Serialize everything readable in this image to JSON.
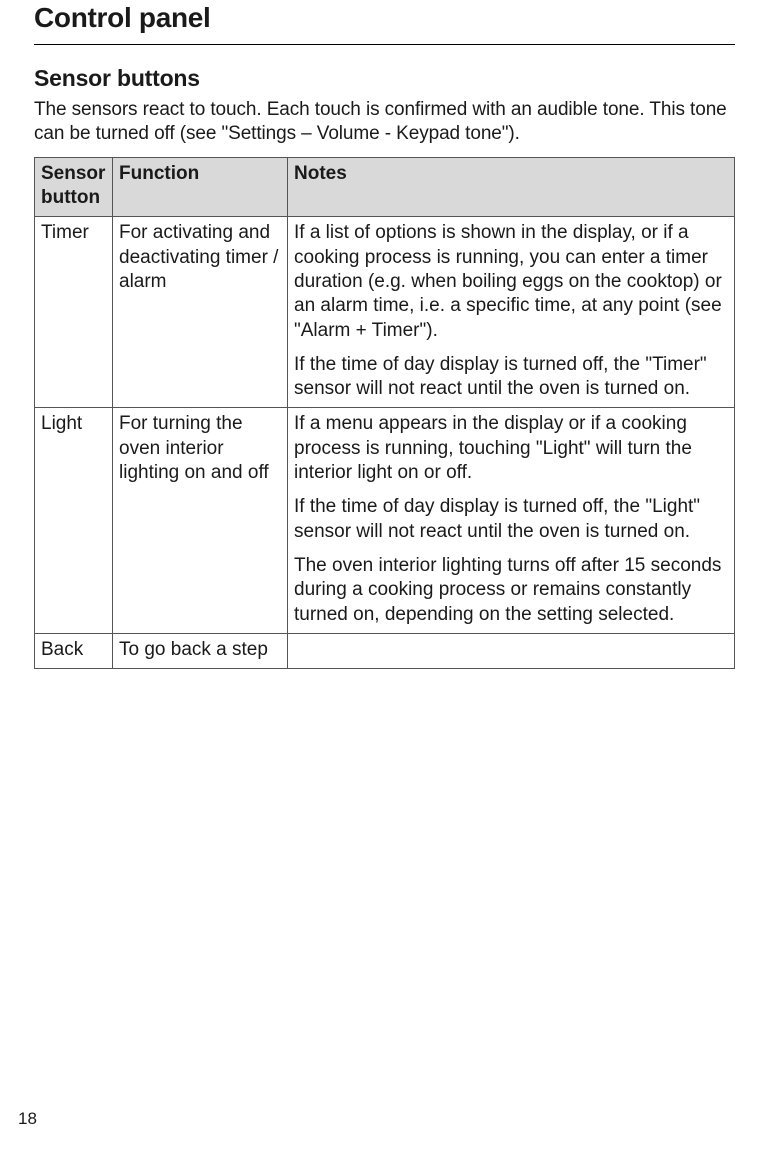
{
  "page_title": "Control panel",
  "section_title": "Sensor buttons",
  "intro_text": "The sensors react to touch. Each touch is confirmed with an audible tone. This tone can be turned off (see \"Settings – Volume - Keypad tone\").",
  "table": {
    "headers": {
      "col1": "Sensor button",
      "col2": "Function",
      "col3": "Notes"
    },
    "rows": [
      {
        "button": "Timer",
        "function": "For activating and deactivating timer / alarm",
        "notes": [
          "If a list of options is shown in the display, or if a cooking process is running, you can enter a timer duration (e.g. when boiling eggs on the cooktop) or an alarm time, i.e. a specific time, at any point (see \"Alarm + Timer\").",
          "If the time of day display is turned off, the \"Timer\" sensor will not react until the oven is turned on."
        ]
      },
      {
        "button": "Light",
        "function": "For turning the oven interior lighting on and off",
        "notes": [
          "If a menu appears in the display or if a cooking process is running, touching \"Light\" will turn the interior light on or off.",
          "If the time of day display is turned off, the \"Light\" sensor will not react until the oven is turned on.",
          "The oven interior lighting turns off after 15 seconds during a cooking process or remains constantly turned on, depending on the setting selected."
        ]
      },
      {
        "button": "Back",
        "function": "To go back a step",
        "notes": [
          ""
        ]
      }
    ]
  },
  "page_number": "18"
}
